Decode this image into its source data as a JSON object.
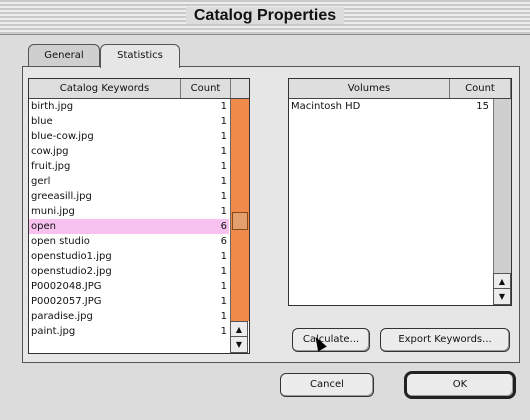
{
  "window": {
    "title": "Catalog Properties"
  },
  "tabs": [
    {
      "label": "General",
      "active": false
    },
    {
      "label": "Statistics",
      "active": true
    }
  ],
  "keywords_list": {
    "column_headers": [
      "Catalog Keywords",
      "Count"
    ],
    "rows": [
      {
        "keyword": "birth.jpg",
        "count": "1"
      },
      {
        "keyword": "blue",
        "count": "1"
      },
      {
        "keyword": "blue-cow.jpg",
        "count": "1"
      },
      {
        "keyword": "cow.jpg",
        "count": "1"
      },
      {
        "keyword": "fruit.jpg",
        "count": "1"
      },
      {
        "keyword": "gerl",
        "count": "1"
      },
      {
        "keyword": "greeasill.jpg",
        "count": "1"
      },
      {
        "keyword": "muni.jpg",
        "count": "1"
      },
      {
        "keyword": "open",
        "count": "6",
        "selected": true
      },
      {
        "keyword": "open studio",
        "count": "6"
      },
      {
        "keyword": "openstudio1.jpg",
        "count": "1"
      },
      {
        "keyword": "openstudio2.jpg",
        "count": "1"
      },
      {
        "keyword": "P0002048.JPG",
        "count": "1"
      },
      {
        "keyword": "P0002057.JPG",
        "count": "1"
      },
      {
        "keyword": "paradise.jpg",
        "count": "1"
      },
      {
        "keyword": "paint.jpg",
        "count": "1"
      }
    ],
    "scroll_position_fraction": 0.55
  },
  "volumes_list": {
    "column_headers": [
      "Volumes",
      "Count"
    ],
    "rows": [
      {
        "volume": "Macintosh HD",
        "count": "15"
      }
    ]
  },
  "buttons": {
    "calculate": "Calculate...",
    "export_keywords": "Export Keywords...",
    "cancel": "Cancel",
    "ok": "OK"
  },
  "colors": {
    "selection": "#f7c2ef",
    "scrollbar_accent": "#f08a4b"
  }
}
